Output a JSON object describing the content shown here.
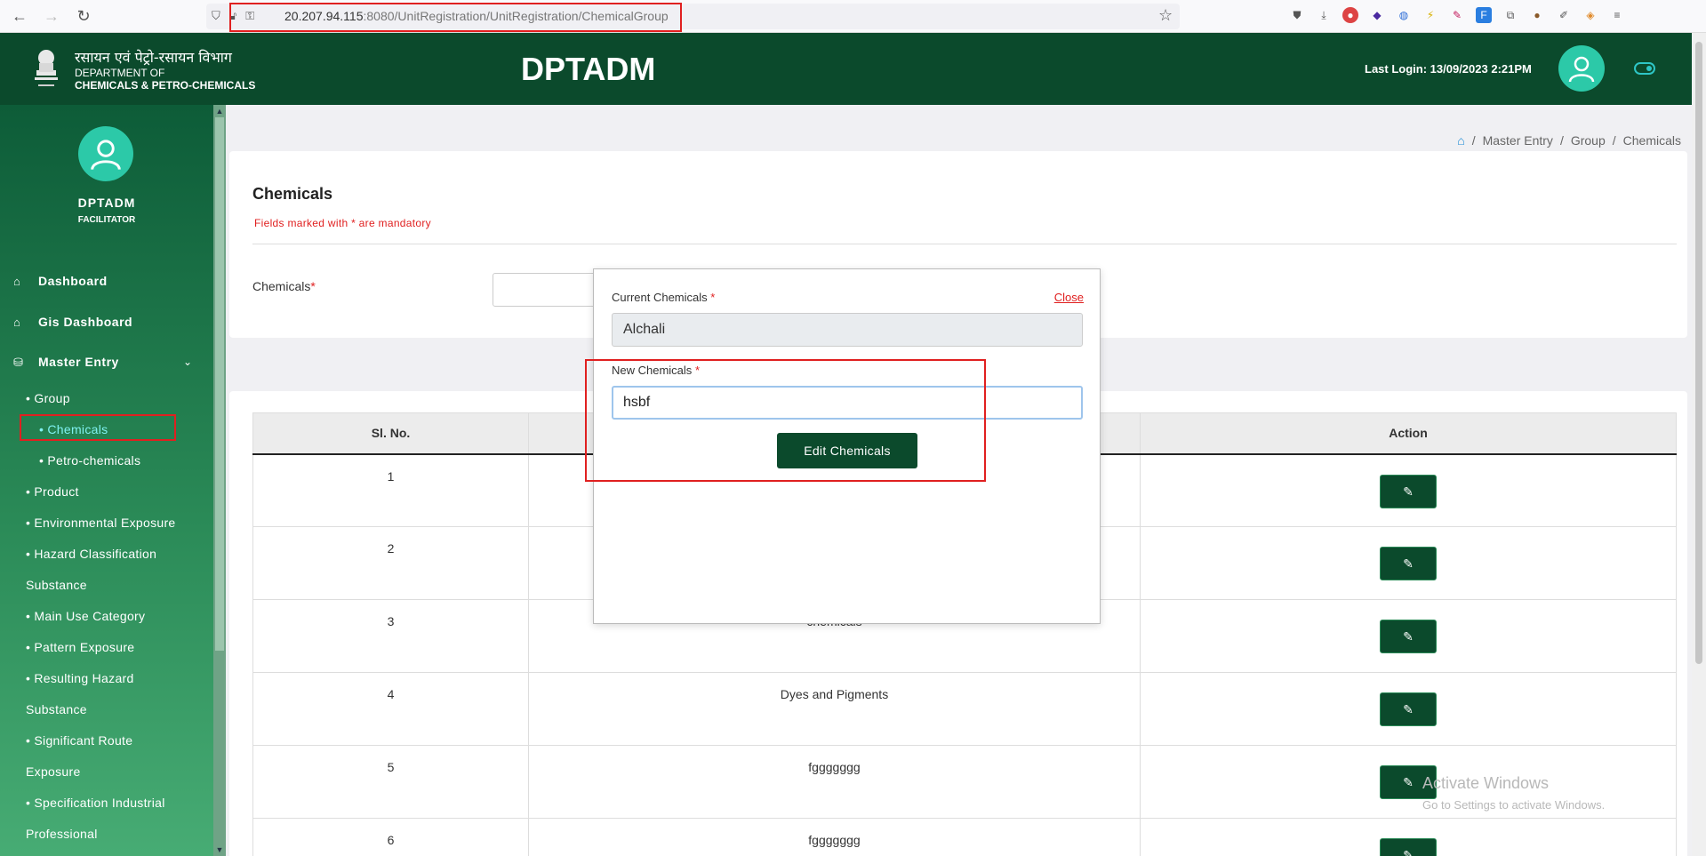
{
  "browser": {
    "url_host": "20.207.94.115",
    "url_path": ":8080/UnitRegistration/UnitRegistration/ChemicalGroup"
  },
  "header": {
    "dept_hindi": "रसायन एवं पेट्रो-रसायन विभाग",
    "dept_line1": "DEPARTMENT OF",
    "dept_line2": "CHEMICALS & PETRO-CHEMICALS",
    "app_title": "DPTADM",
    "last_login": "Last Login: 13/09/2023 2:21PM"
  },
  "sidebar": {
    "user_name": "DPTADM",
    "user_role": "FACILITATOR",
    "dashboard": "Dashboard",
    "gis_dashboard": "Gis Dashboard",
    "master_entry": "Master Entry",
    "group": "• Group",
    "chemicals": "• Chemicals",
    "petro": "• Petro-chemicals",
    "product": "• Product",
    "env_exposure": "• Environmental Exposure",
    "hazard1": "• Hazard Classification",
    "hazard2": "Substance",
    "main_use": "• Main Use Category",
    "pattern": "• Pattern Exposure",
    "resulting1": "• Resulting Hazard",
    "resulting2": "Substance",
    "significant1": "• Significant Route",
    "significant2": "Exposure",
    "spec1": "• Specification Industrial",
    "spec2": "Professional"
  },
  "breadcrumb": {
    "sep": "/",
    "master_entry": "Master Entry",
    "group": "Group",
    "current": "Chemicals"
  },
  "form": {
    "title": "Chemicals",
    "mandatory_note": "Fields marked with * are mandatory",
    "chemicals_label": "Chemicals",
    "required_mark": "*"
  },
  "table": {
    "headers": {
      "sl": "Sl. No.",
      "action": "Action"
    },
    "rows": [
      {
        "sl": "1",
        "name": ""
      },
      {
        "sl": "2",
        "name": ""
      },
      {
        "sl": "3",
        "name": "chemicals"
      },
      {
        "sl": "4",
        "name": "Dyes and Pigments"
      },
      {
        "sl": "5",
        "name": "fggggggg"
      },
      {
        "sl": "6",
        "name": "fggggggg"
      }
    ]
  },
  "modal": {
    "current_label": "Current Chemicals",
    "new_label": "New Chemicals",
    "required_mark": "*",
    "close_label": "Close",
    "current_value": "Alchali",
    "new_value": "hsbf",
    "button_label": "Edit Chemicals"
  },
  "watermark": {
    "line1": "Activate Windows",
    "line2": "Go to Settings to activate Windows."
  },
  "colors": {
    "header_green": "#0b4a2c",
    "accent_red": "#e02020",
    "avatar_teal": "#2cc9a8"
  }
}
